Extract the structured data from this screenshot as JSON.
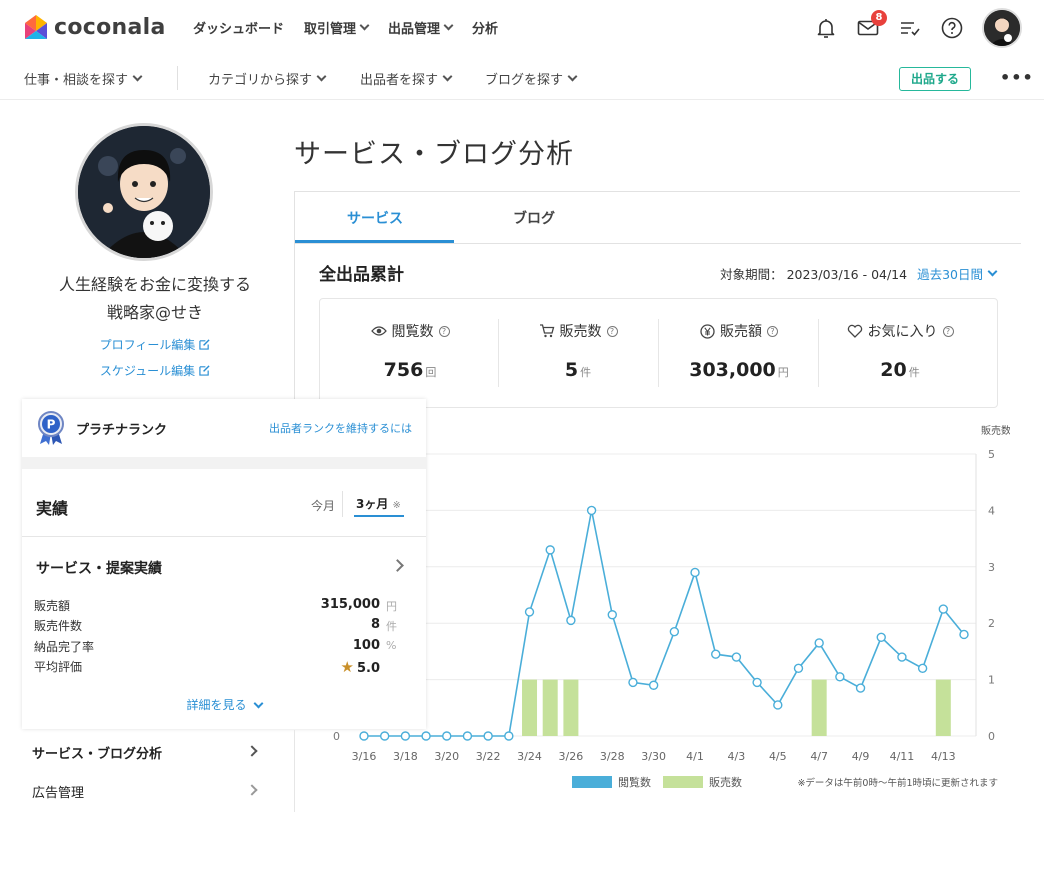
{
  "header": {
    "logo_text": "coconala",
    "nav": [
      "ダッシュボード",
      "取引管理",
      "出品管理",
      "分析"
    ],
    "mail_badge": "8"
  },
  "subheader": {
    "nav": [
      "仕事・相談を探す",
      "カテゴリから探す",
      "出品者を探す",
      "ブログを探す"
    ],
    "post_button": "出品する",
    "more": "•••"
  },
  "profile": {
    "name_line1": "人生経験をお金に変換する",
    "name_line2": "戦略家@せき",
    "edit_profile": "プロフィール編集",
    "edit_schedule": "スケジュール編集"
  },
  "rank": {
    "medal_letter": "P",
    "name": "プラチナランク",
    "link": "出品者ランクを維持するには"
  },
  "performance": {
    "title": "実績",
    "tab_month": "今月",
    "tab_3m": "3ヶ月",
    "tab_3m_note": "※",
    "section_title": "サービス・提案実績",
    "stats": [
      {
        "label": "販売額",
        "value": "315,000",
        "unit": "円"
      },
      {
        "label": "販売件数",
        "value": "8",
        "unit": "件"
      },
      {
        "label": "納品完了率",
        "value": "100",
        "unit": "%"
      },
      {
        "label": "平均評価",
        "value": "5.0",
        "unit": ""
      }
    ],
    "detail_link": "詳細を見る"
  },
  "sidebar_links": [
    "サービス・ブログ分析",
    "広告管理"
  ],
  "main": {
    "page_title": "サービス・ブログ分析",
    "tabs": [
      "サービス",
      "ブログ"
    ],
    "total_title": "全出品累計",
    "period_label": "対象期間：",
    "period_value": "2023/03/16 - 04/14",
    "period_select": "過去30日間"
  },
  "kpis": [
    {
      "icon": "eye-icon",
      "label": "閲覧数",
      "value": "756",
      "unit": "回"
    },
    {
      "icon": "cart-icon",
      "label": "販売数",
      "value": "5",
      "unit": "件"
    },
    {
      "icon": "yen-icon",
      "label": "販売額",
      "value": "303,000",
      "unit": "円"
    },
    {
      "icon": "heart-icon",
      "label": "お気に入り",
      "value": "20",
      "unit": "件"
    }
  ],
  "colors": {
    "accent": "#2a8fd4",
    "views_line": "#4aaed9",
    "sales_bar": "#c5e19a",
    "post_button": "#26b89b"
  },
  "chart_data": {
    "type": "bar+line",
    "right_axis_label": "販売数",
    "ylim": [
      0,
      5
    ],
    "yticks": [
      0,
      1,
      2,
      3,
      4,
      5
    ],
    "left_axis_visible_tick": "0",
    "x": [
      "3/16",
      "3/17",
      "3/18",
      "3/19",
      "3/20",
      "3/21",
      "3/22",
      "3/23",
      "3/24",
      "3/25",
      "3/26",
      "3/27",
      "3/28",
      "3/29",
      "3/30",
      "3/31",
      "4/1",
      "4/2",
      "4/3",
      "4/4",
      "4/5",
      "4/6",
      "4/7",
      "4/8",
      "4/9",
      "4/10",
      "4/11",
      "4/12",
      "4/13",
      "4/14"
    ],
    "x_tick_labels": [
      "3/16",
      "3/18",
      "3/20",
      "3/22",
      "3/24",
      "3/26",
      "3/28",
      "3/30",
      "4/1",
      "4/3",
      "4/5",
      "4/7",
      "4/9",
      "4/11",
      "4/13"
    ],
    "series": [
      {
        "name": "閲覧数",
        "kind": "line",
        "values": [
          0,
          0,
          0,
          0,
          0,
          0,
          0,
          0,
          2.2,
          3.3,
          2.05,
          4.0,
          2.15,
          0.95,
          0.9,
          1.85,
          2.9,
          1.45,
          1.4,
          0.95,
          0.55,
          1.2,
          1.65,
          1.05,
          0.85,
          1.75,
          1.4,
          1.2,
          2.25,
          1.8
        ]
      },
      {
        "name": "販売数",
        "kind": "bar",
        "values": [
          0,
          0,
          0,
          0,
          0,
          0,
          0,
          0,
          1,
          1,
          1,
          0,
          0,
          0,
          0,
          0,
          0,
          0,
          0,
          0,
          0,
          0,
          1,
          0,
          0,
          0,
          0,
          0,
          1,
          0
        ]
      }
    ],
    "legend": [
      "閲覧数",
      "販売数"
    ],
    "footnote": "※データは午前0時〜午前1時頃に更新されます"
  }
}
